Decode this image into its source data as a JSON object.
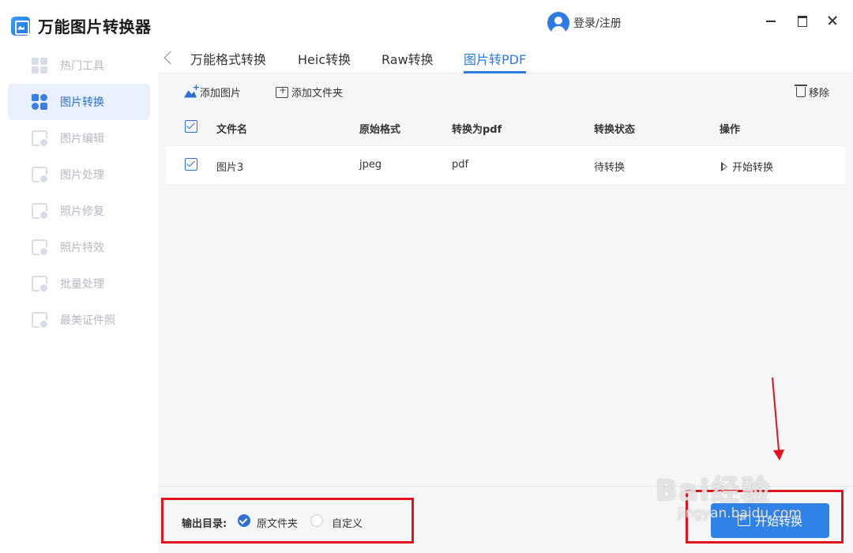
{
  "app": {
    "title": "万能图片转换器"
  },
  "sidebar": {
    "items": [
      {
        "label": "热门工具",
        "icon": "grid-icon",
        "active": false
      },
      {
        "label": "图片转换",
        "icon": "image-convert-icon",
        "active": true
      },
      {
        "label": "图片编辑",
        "icon": "image-edit-icon",
        "active": false
      },
      {
        "label": "图片处理",
        "icon": "image-process-icon",
        "active": false
      },
      {
        "label": "照片修复",
        "icon": "photo-repair-icon",
        "active": false
      },
      {
        "label": "照片特效",
        "icon": "photo-effect-icon",
        "active": false
      },
      {
        "label": "批量处理",
        "icon": "batch-icon",
        "active": false
      },
      {
        "label": "最美证件照",
        "icon": "id-photo-icon",
        "active": false
      }
    ]
  },
  "topbar": {
    "user_label": "登录/注册"
  },
  "tabs": [
    {
      "label": "万能格式转换",
      "active": false
    },
    {
      "label": "Heic转换",
      "active": false
    },
    {
      "label": "Raw转换",
      "active": false
    },
    {
      "label": "图片转PDF",
      "active": true
    }
  ],
  "toolbar": {
    "add_image": "添加图片",
    "add_folder": "添加文件夹",
    "remove": "移除"
  },
  "table": {
    "headers": {
      "name": "文件名",
      "format": "原始格式",
      "target": "转换为pdf",
      "status": "转换状态",
      "action": "操作"
    },
    "rows": [
      {
        "checked": true,
        "name": "图片3",
        "format": "jpeg",
        "target": "pdf",
        "status": "待转换",
        "action": "开始转换"
      }
    ]
  },
  "footer": {
    "output_label": "输出目录:",
    "options": [
      {
        "label": "原文件夹",
        "selected": true
      },
      {
        "label": "自定义",
        "selected": false
      }
    ],
    "convert_button": "开始转换"
  },
  "watermark": {
    "main": "Bai经验",
    "sub": "jingyan.baidu.com"
  },
  "colors": {
    "accent": "#2f82e8",
    "annotation": "#e0141c",
    "active_nav_bg": "#e8f1fd"
  }
}
